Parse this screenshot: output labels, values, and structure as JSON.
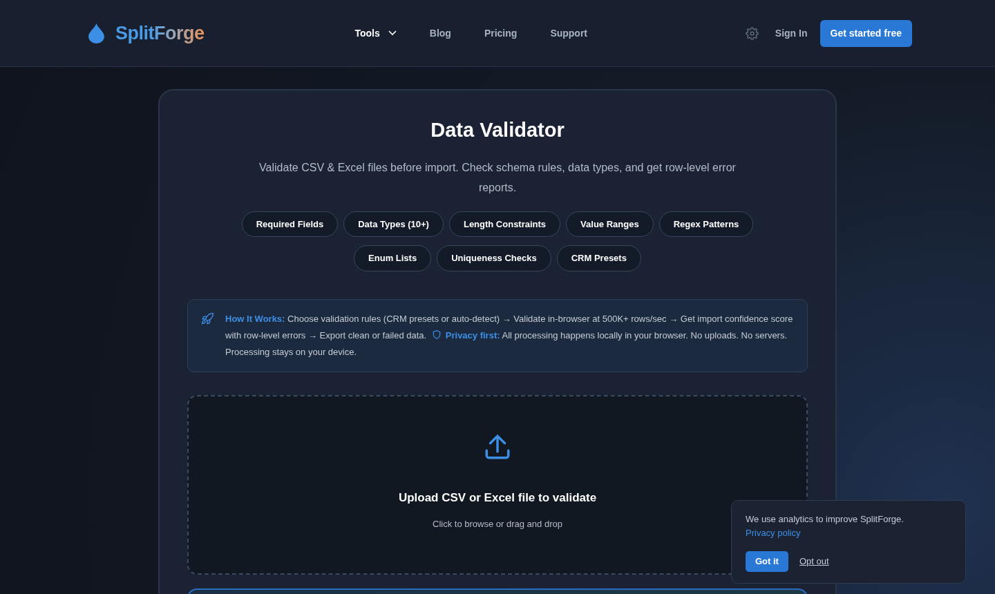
{
  "brand": {
    "name": "SplitForge"
  },
  "nav": [
    {
      "label": "Tools",
      "selected": true,
      "dropdown": true
    },
    {
      "label": "Blog",
      "selected": false,
      "dropdown": false
    },
    {
      "label": "Pricing",
      "selected": false,
      "dropdown": false
    },
    {
      "label": "Support",
      "selected": false,
      "dropdown": false
    }
  ],
  "actions": {
    "sign_in": "Sign In",
    "cta": "Get started free"
  },
  "hero": {
    "title": "Data Validator",
    "subtitle": "Validate CSV & Excel files before import. Check schema rules, data types, and get row-level error reports."
  },
  "features": [
    [
      "Required Fields",
      "Data Types (10+)",
      "Length Constraints",
      "Value Ranges",
      "Regex Patterns"
    ],
    [
      "Enum Lists",
      "Uniqueness Checks",
      "CRM Presets"
    ]
  ],
  "info": {
    "text": "**How It Works:** Choose validation rules (CRM presets or auto-detect) → Validate in-browser at 500K+ rows/sec → Get import confidence score with row-level errors → Export clean or failed data.",
    "privacy": "**Privacy first:** All processing happens locally in your browser. No uploads. No servers. Processing stays on your device."
  },
  "upload": {
    "title": "Upload CSV or Excel file to validate",
    "hint": "Click to browse or drag and drop"
  },
  "cookie": {
    "text": "We use analytics to improve SplitForge.",
    "link": "Privacy policy",
    "accept": "Got it",
    "decline": "Opt out"
  }
}
